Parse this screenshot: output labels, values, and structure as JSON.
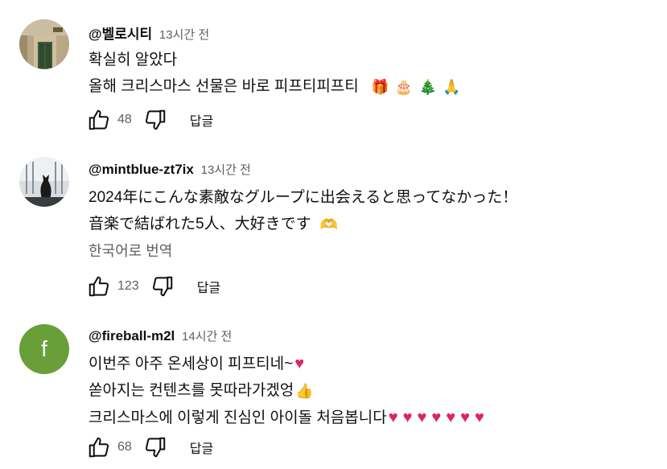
{
  "comments": [
    {
      "handle": "@벨로시티",
      "time": "13시간 전",
      "lines": [
        "확실히 알았다",
        "올해 크리스마스 선물은 바로 피프티피프티"
      ],
      "emojis": [
        "🎁",
        "🎂",
        "🎄",
        "🙏"
      ],
      "likes": "48",
      "reply": "답글"
    },
    {
      "handle": "@mintblue-zt7ix",
      "time": "13시간 전",
      "lines": [
        "2024年にこんな素敵なグループに出会えると思ってなかった！",
        "音楽で結ばれた5人、大好きです"
      ],
      "emojis": [
        "🫶"
      ],
      "translate": "한국어로 번역",
      "likes": "123",
      "reply": "답글"
    },
    {
      "handle": "@fireball-m2l",
      "time": "14시간 전",
      "avatar_letter": "f",
      "avatar_color": "#689f38",
      "lines": [
        "이번주 아주 온세상이 피프티네~",
        "쏟아지는 컨텐츠를 못따라가겠엉",
        "크리스마스에 이렇게 진심인 아이돌 처음봅니다"
      ],
      "emojis_line1": [
        "♥"
      ],
      "emojis_line2": [
        "👍"
      ],
      "emojis_line3": [
        "♥",
        "♥",
        "♥",
        "♥",
        "♥",
        "♥",
        "♥"
      ],
      "likes": "68",
      "reply": "답글"
    }
  ],
  "icons": {
    "like": "thumbs-up-icon",
    "dislike": "thumbs-down-icon"
  },
  "colors": {
    "heart": "#e0245e",
    "muted": "#606060"
  }
}
